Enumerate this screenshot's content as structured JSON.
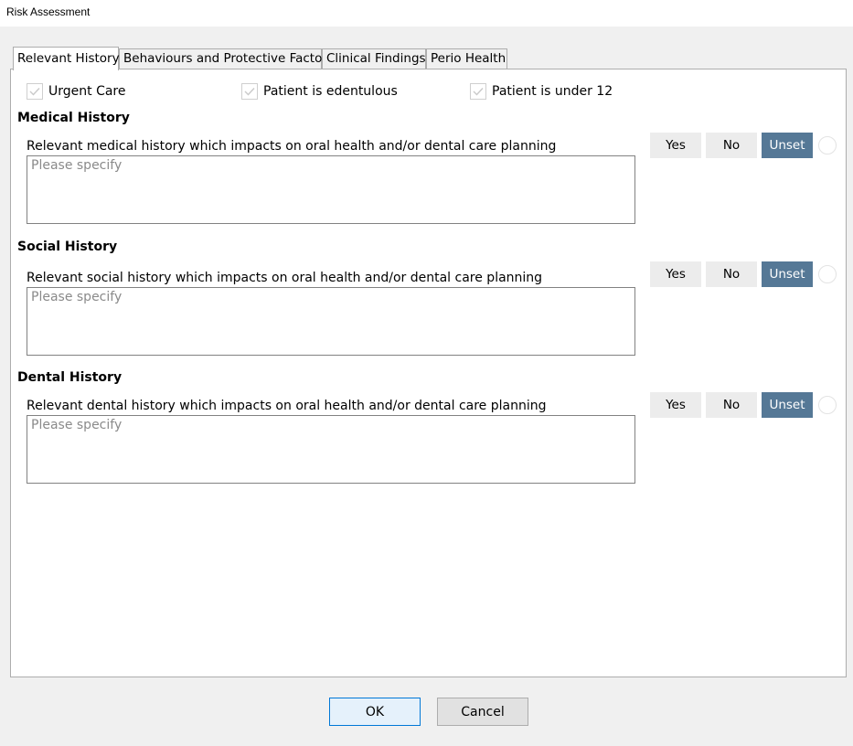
{
  "window": {
    "title": "Risk Assessment"
  },
  "tabs": [
    {
      "label": "Relevant History",
      "active": true
    },
    {
      "label": "Behaviours and Protective Factors",
      "active": false
    },
    {
      "label": "Clinical Findings",
      "active": false
    },
    {
      "label": "Perio Health",
      "active": false
    }
  ],
  "flags": [
    {
      "label": "Urgent Care",
      "checked": false
    },
    {
      "label": "Patient is edentulous",
      "checked": false
    },
    {
      "label": "Patient is under 12",
      "checked": false
    }
  ],
  "segment_labels": {
    "yes": "Yes",
    "no": "No",
    "unset": "Unset"
  },
  "sections": [
    {
      "title": "Medical History",
      "question": "Relevant medical history which impacts on oral health and/or dental care planning",
      "placeholder": "Please specify",
      "value": "",
      "selected": "Unset"
    },
    {
      "title": "Social History",
      "question": "Relevant social history which impacts on oral health and/or dental care planning",
      "placeholder": "Please specify",
      "value": "",
      "selected": "Unset"
    },
    {
      "title": "Dental History",
      "question": "Relevant dental history which impacts on oral health and/or dental care planning",
      "placeholder": "Please specify",
      "value": "",
      "selected": "Unset"
    }
  ],
  "buttons": {
    "ok": "OK",
    "cancel": "Cancel"
  },
  "colors": {
    "accent": "#557896",
    "segment_bg": "#ececec",
    "panel_border": "#adadad"
  }
}
